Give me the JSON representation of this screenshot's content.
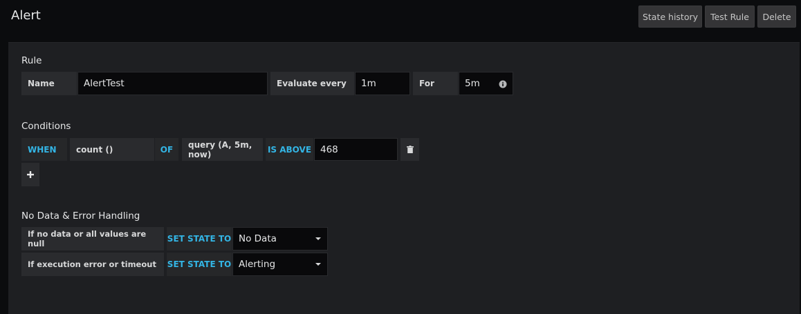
{
  "header": {
    "title": "Alert",
    "buttons": {
      "state_history": "State history",
      "test_rule": "Test Rule",
      "delete": "Delete"
    }
  },
  "rule": {
    "title": "Rule",
    "name_label": "Name",
    "name_value": "AlertTest",
    "evaluate_label": "Evaluate every",
    "evaluate_value": "1m",
    "for_label": "For",
    "for_value": "5m"
  },
  "conditions": {
    "title": "Conditions",
    "when": "WHEN",
    "reducer": "count ()",
    "of": "OF",
    "query": "query (A, 5m, now)",
    "evaluator": "IS ABOVE",
    "threshold": "468"
  },
  "no_data": {
    "title": "No Data & Error Handling",
    "rows": [
      {
        "label": "If no data or all values are null",
        "action": "SET STATE TO",
        "value": "No Data"
      },
      {
        "label": "If execution error or timeout",
        "action": "SET STATE TO",
        "value": "Alerting"
      }
    ]
  },
  "colors": {
    "keyword": "#33b5e5",
    "background": "#0b0c0e",
    "panel": "#1e1f22"
  },
  "icons": [
    "info-icon",
    "trash-icon",
    "plus-icon",
    "chevron-down-icon"
  ]
}
